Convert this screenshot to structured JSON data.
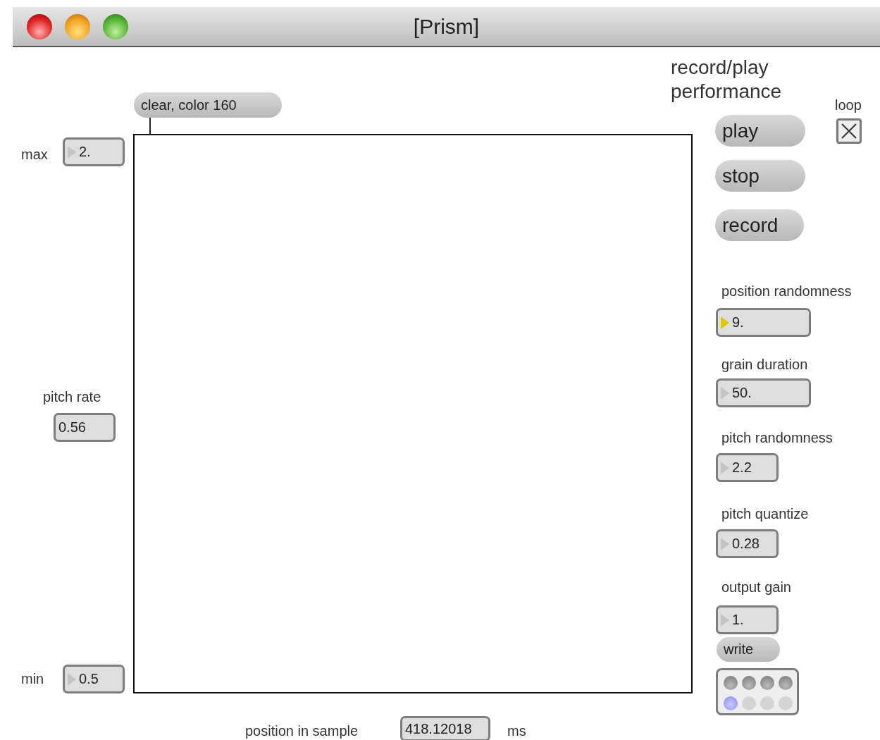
{
  "window": {
    "title": "[Prism]"
  },
  "clear_message": "clear, color 160",
  "range": [
    {
      "label": "max",
      "value": "2.",
      "active": false
    },
    {
      "label": "pitch rate",
      "value": "0.56"
    },
    {
      "label": "min",
      "value": "0.5",
      "active": false
    }
  ],
  "position": {
    "label": "position in sample",
    "value": "418.12018",
    "unit": "ms"
  },
  "performance": {
    "title": "record/play performance",
    "buttons": [
      "play",
      "stop",
      "record"
    ],
    "loop": {
      "label": "loop",
      "checked": true
    }
  },
  "params": [
    {
      "label": "position randomness",
      "value": "9.",
      "active": true
    },
    {
      "label": "grain duration",
      "value": "50.",
      "active": false
    },
    {
      "label": "pitch randomness",
      "value": "2.2",
      "active": false
    },
    {
      "label": "pitch quantize",
      "value": "0.28",
      "active": false
    },
    {
      "label": "output gain",
      "value": "1.",
      "active": false
    }
  ],
  "write_message": "write",
  "presets": [
    {
      "stored": true,
      "selected": false
    },
    {
      "stored": true,
      "selected": false
    },
    {
      "stored": true,
      "selected": false
    },
    {
      "stored": true,
      "selected": false
    },
    {
      "stored": false,
      "selected": true
    },
    {
      "stored": false,
      "selected": false
    },
    {
      "stored": false,
      "selected": false
    },
    {
      "stored": false,
      "selected": false
    }
  ]
}
